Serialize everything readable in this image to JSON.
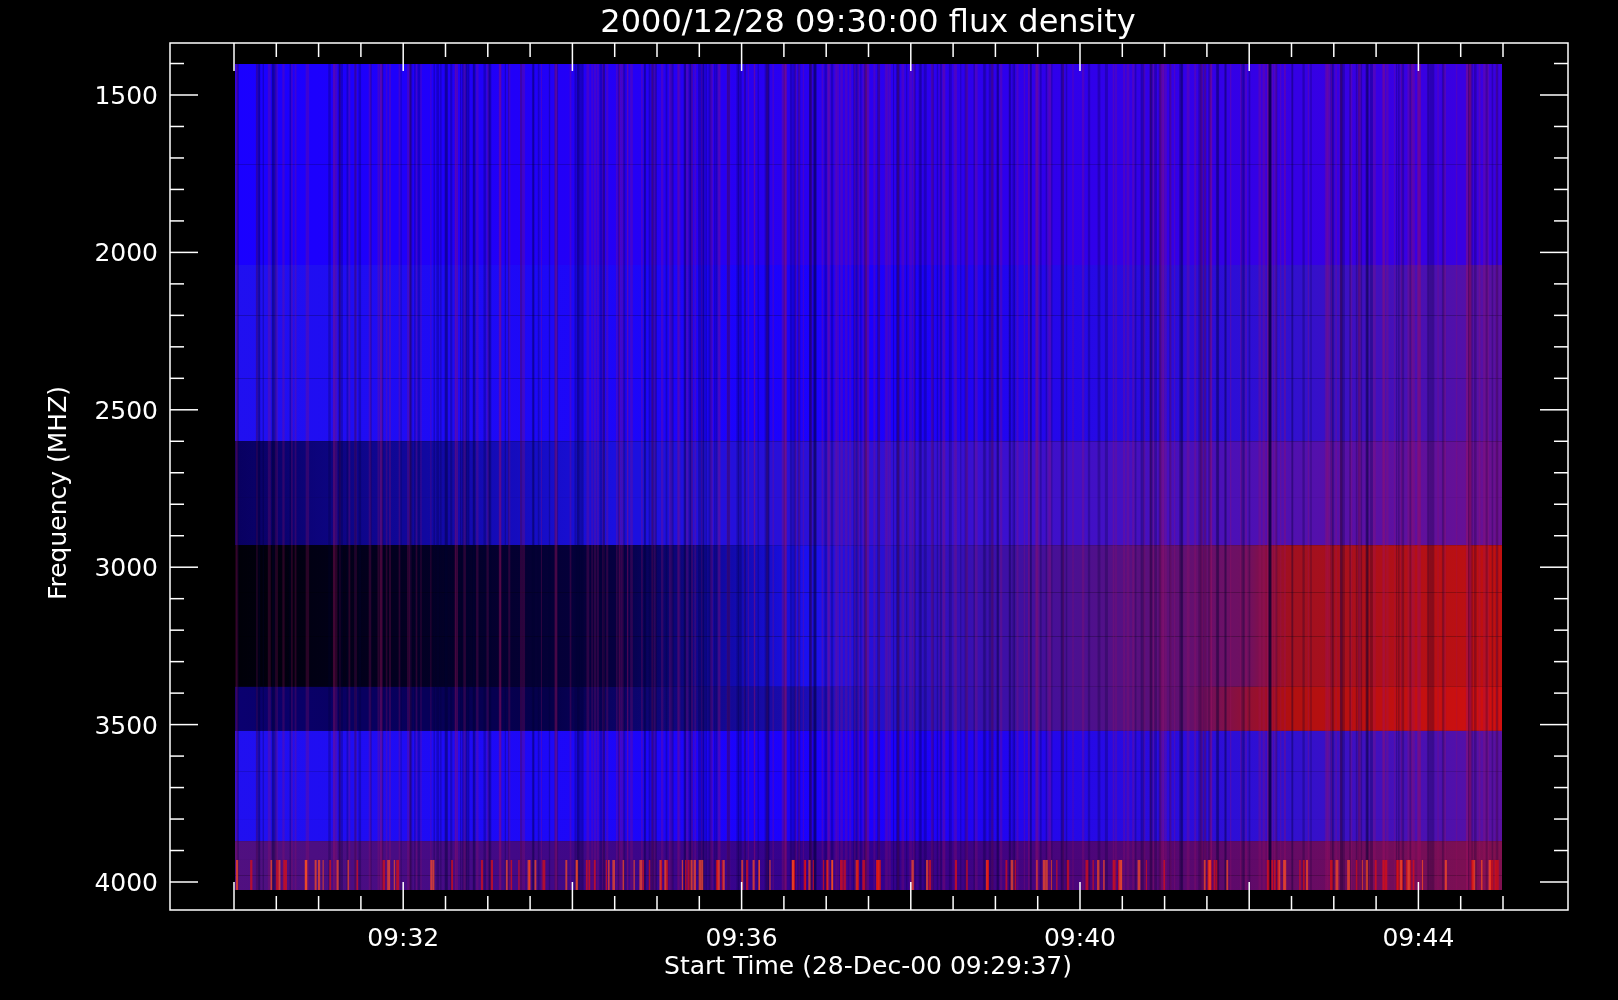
{
  "plot": {
    "title": "2000/12/28 09:30:00 flux density",
    "ylabel": "Frequency (MHZ)",
    "xlabel": "Start Time (28-Dec-00 09:29:37)",
    "yticks": [
      "1500",
      "2000",
      "2500",
      "3000",
      "3500",
      "4000"
    ],
    "xticks": [
      "09:32",
      "09:36",
      "09:40",
      "09:44"
    ]
  }
}
